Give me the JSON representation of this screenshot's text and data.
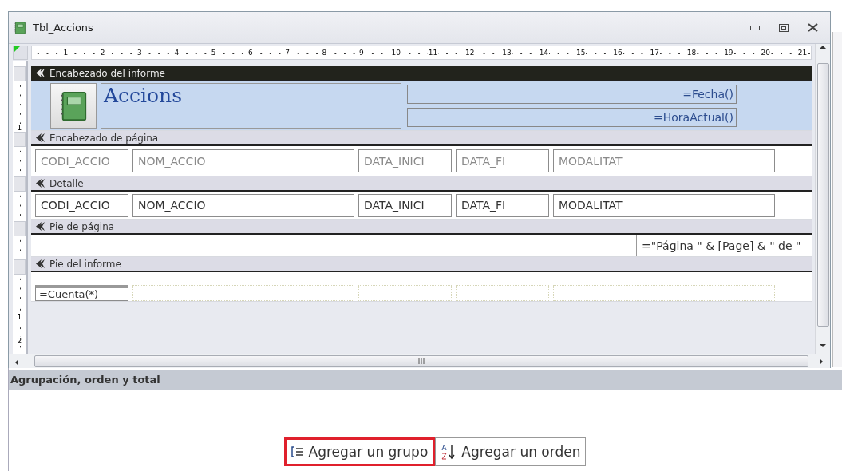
{
  "window": {
    "title": "Tbl_Accions"
  },
  "ruler": [
    "1",
    "2",
    "3",
    "4",
    "5",
    "6",
    "7",
    "8",
    "9",
    "10",
    "11",
    "12",
    "13",
    "14",
    "15",
    "16",
    "17",
    "18",
    "19",
    "20",
    "21"
  ],
  "sections": [
    {
      "kind": "report_header",
      "title": "Encabezado del informe",
      "ruler_label": "1",
      "report_title": "Accions",
      "fields": [
        "=Fecha()",
        "=HoraActual()"
      ]
    },
    {
      "kind": "controls",
      "title": "Encabezado de página",
      "controls": [
        {
          "kind": "label",
          "text": "CODI_ACCIO"
        },
        {
          "kind": "label",
          "text": "NOM_ACCIO"
        },
        {
          "kind": "label",
          "text": "DATA_INICI"
        },
        {
          "kind": "label",
          "text": "DATA_FI"
        },
        {
          "kind": "label",
          "text": "MODALITAT"
        }
      ]
    },
    {
      "kind": "controls",
      "title": "Detalle",
      "controls": [
        {
          "kind": "field",
          "text": "CODI_ACCIO"
        },
        {
          "kind": "field",
          "text": "NOM_ACCIO"
        },
        {
          "kind": "field",
          "text": "DATA_INICI"
        },
        {
          "kind": "field",
          "text": "DATA_FI"
        },
        {
          "kind": "field",
          "text": "MODALITAT"
        }
      ]
    },
    {
      "kind": "page_footer",
      "title": "Pie de página",
      "expression": "=\"Página \" & [Page] & \" de \""
    },
    {
      "kind": "report_footer",
      "title": "Pie del informe",
      "expression": "=Cuenta(*)"
    }
  ],
  "empty_area_ruler": [
    "1",
    "2"
  ],
  "pane": {
    "title": "Agrupación, orden y total",
    "buttons": [
      {
        "kind": "group",
        "label": "Agregar un grupo",
        "highlighted": true
      },
      {
        "kind": "sort",
        "label": "Agregar un orden",
        "highlighted": false
      }
    ]
  }
}
